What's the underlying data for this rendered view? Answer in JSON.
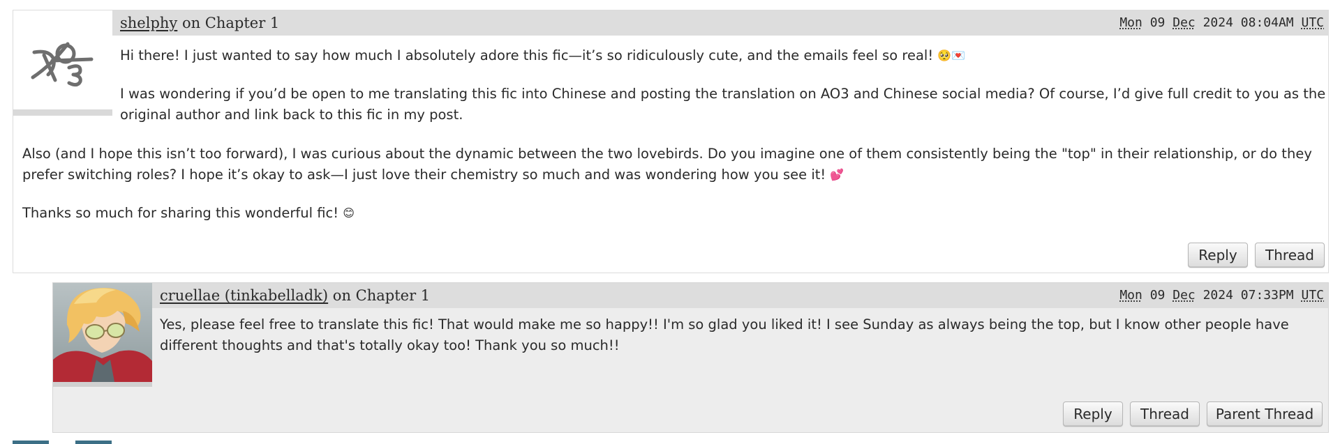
{
  "comments": [
    {
      "author": "shelphy",
      "on_text": " on Chapter 1",
      "date": {
        "day": "Mon",
        "num": "09",
        "month": "Dec",
        "year_time": "2024 08:04AM",
        "tz": "UTC"
      },
      "icon": "ao3-default-icon",
      "paragraphs": [
        "Hi there! I just wanted to say how much I absolutely adore this fic—it’s so ridiculously cute, and the emails feel so real! ",
        "I was wondering if you’d be open to me translating this fic into Chinese and posting the translation on AO3 and Chinese social media? Of course, I’d give full credit to you as the",
        "original author and link back to this fic in my post.",
        "Also (and I hope this isn’t too forward), I was curious about the dynamic between the two lovebirds. Do you imagine one of them consistently being the \"top\" in their relationship, or do they",
        "prefer switching roles? I hope it’s okay to ask—I just love their chemistry so much and was wondering how you see it! ",
        "Thanks so much for sharing this wonderful fic! "
      ],
      "emojis": [
        "🥺💌",
        "💕",
        "😊"
      ],
      "actions": [
        "Reply",
        "Thread"
      ]
    },
    {
      "author": "cruellae (tinkabelladk)",
      "on_text": " on Chapter 1",
      "date": {
        "day": "Mon",
        "num": "09",
        "month": "Dec",
        "year_time": "2024 07:33PM",
        "tz": "UTC"
      },
      "icon": "user-avatar-blonde-character",
      "paragraphs": [
        "Yes, please feel free to translate this fic! That would make me so happy!! I'm so glad you liked it! I see Sunday as always being the top, but I know other people have",
        "different thoughts and that's totally okay too! Thank you so much!!"
      ],
      "actions": [
        "Reply",
        "Thread",
        "Parent Thread"
      ]
    }
  ],
  "colors": {
    "header_bg": "#dddddd",
    "reply_bg": "#ededed",
    "text": "#2a2a2a"
  }
}
